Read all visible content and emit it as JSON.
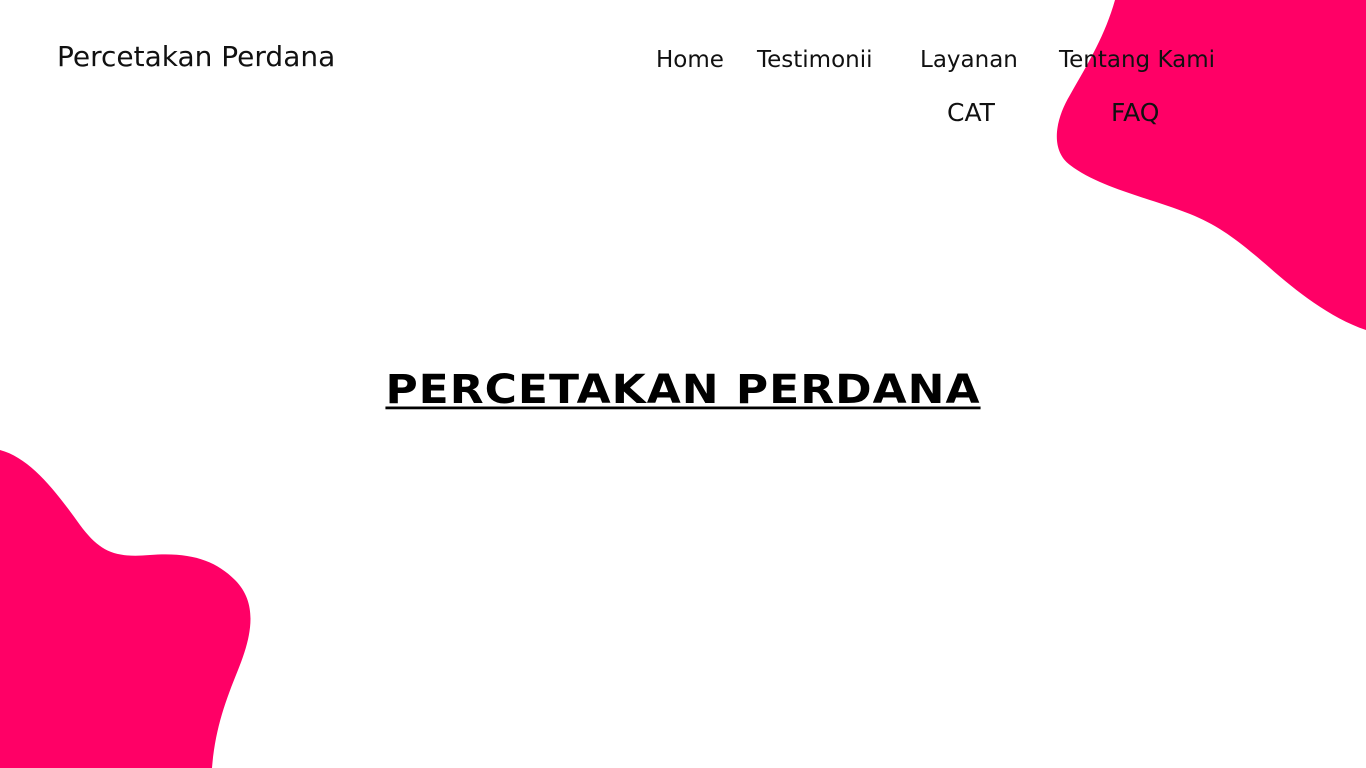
{
  "brand": {
    "name": "Percetakan Perdana"
  },
  "nav": {
    "items": [
      {
        "label": "Home"
      },
      {
        "label": "Testimonii"
      },
      {
        "label": "Layanan"
      },
      {
        "label": "Tentang Kami"
      },
      {
        "label": "CAT"
      },
      {
        "label": "FAQ"
      }
    ]
  },
  "hero": {
    "title": "PERCETAKAN PERDANA"
  },
  "colors": {
    "accent": "#ff0066",
    "text": "#111111",
    "background": "#ffffff"
  }
}
